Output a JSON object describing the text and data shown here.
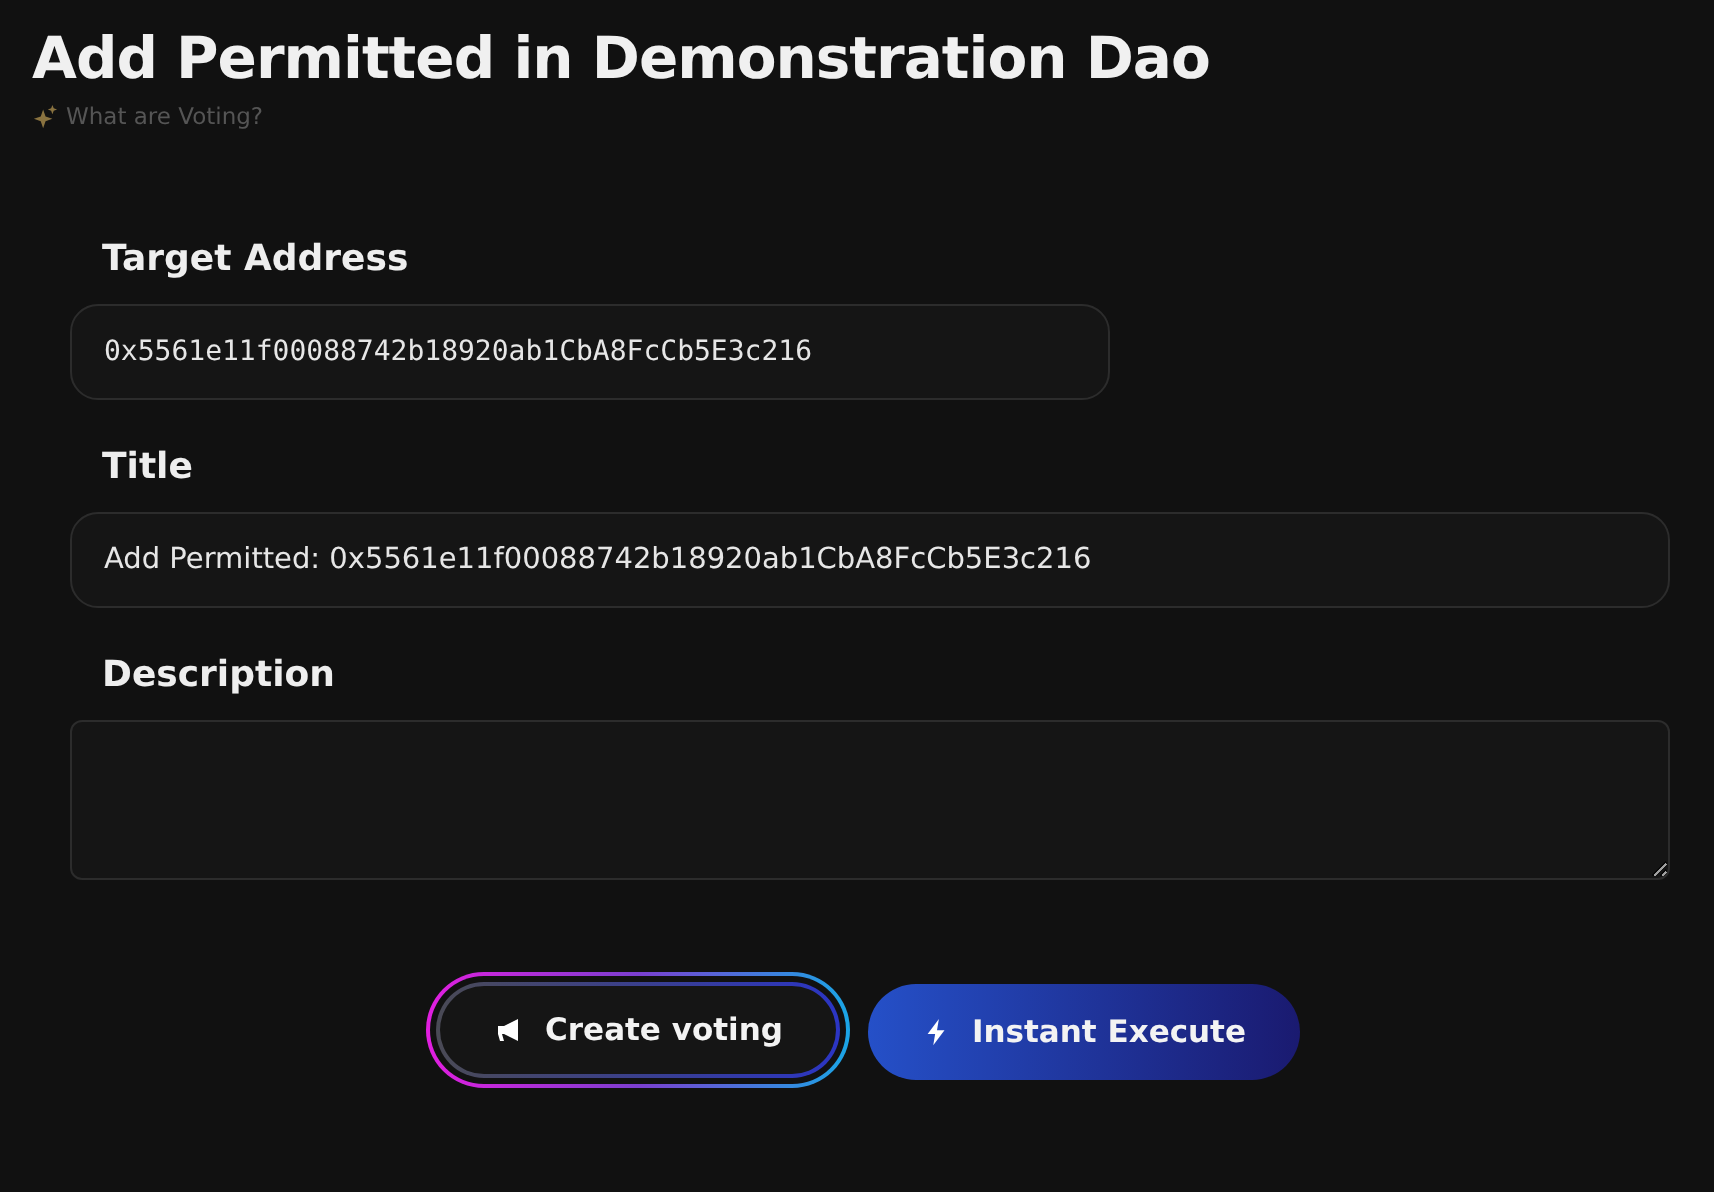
{
  "header": {
    "title": "Add Permitted in Demonstration Dao",
    "help_link": "What are Voting?"
  },
  "fields": [
    {
      "kind": "mono",
      "label": "Target Address",
      "value": "0x5561e11f00088742b18920ab1CbA8FcCb5E3c216"
    },
    {
      "kind": "text",
      "label": "Title",
      "value": "Add Permitted: 0x5561e11f00088742b18920ab1CbA8FcCb5E3c216"
    },
    {
      "kind": "textarea",
      "label": "Description"
    }
  ],
  "buttons": [
    {
      "kind": "outline",
      "label": "Create voting"
    },
    {
      "kind": "filled",
      "label": "Instant Execute"
    }
  ]
}
